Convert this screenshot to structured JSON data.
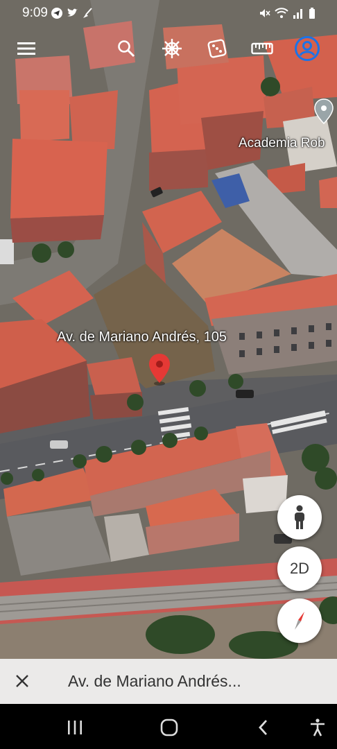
{
  "status_bar": {
    "time": "9:09"
  },
  "toolbar": {
    "menu_icon": "menu-icon",
    "search_icon": "search-icon",
    "voyager_icon": "ship-wheel-icon",
    "feeling_lucky_icon": "dice-icon",
    "measure_icon": "ruler-icon",
    "account_icon": "account-icon",
    "accent_color": "#1a73e8"
  },
  "map": {
    "place_label": "Academia Rob",
    "address_label": "Av. de Mariano Andrés, 105",
    "pin_color": "#e53935"
  },
  "controls": {
    "street_view_icon": "pegman-icon",
    "view_mode_label": "2D",
    "compass_icon": "compass-icon"
  },
  "search_bar": {
    "close_icon": "close-icon",
    "query": "Av. de Mariano Andrés..."
  },
  "nav_bar": {
    "recents_icon": "recents-icon",
    "home_icon": "home-icon",
    "back_icon": "back-icon",
    "accessibility_icon": "accessibility-icon"
  }
}
